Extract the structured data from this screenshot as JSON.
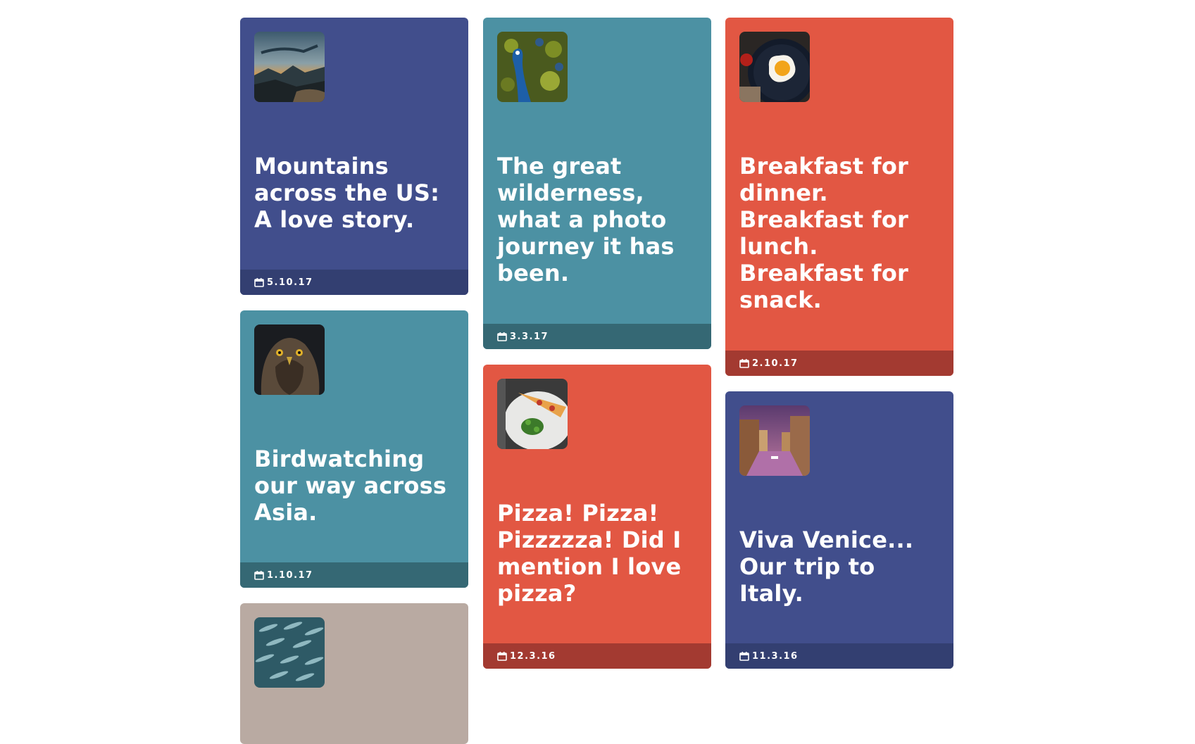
{
  "cards": [
    {
      "title": "Mountains across the US: A love story.",
      "date": "5.10.17",
      "color": "#414e8c",
      "footer_color": "#333f71",
      "image": "mountain-landscape-image",
      "date_icon": "calendar-icon"
    },
    {
      "title": "The great wilderness, what a photo journey it has been.",
      "date": "3.3.17",
      "color": "#4c91a3",
      "footer_color": "#356874",
      "image": "peacock-image",
      "date_icon": "calendar-icon"
    },
    {
      "title": "Breakfast for dinner. Breakfast for lunch. Breakfast for snack.",
      "date": "2.10.17",
      "color": "#e25743",
      "footer_color": "#a33a31",
      "image": "fried-egg-pan-image",
      "date_icon": "calendar-icon"
    },
    {
      "title": "Birdwatching our way across Asia.",
      "date": "1.10.17",
      "color": "#4c91a3",
      "footer_color": "#356874",
      "image": "hawk-image",
      "date_icon": "calendar-icon"
    },
    {
      "title": "Pizza! Pizza! Pizzzzza! Did I mention I love pizza?",
      "date": "12.3.16",
      "color": "#e25743",
      "footer_color": "#a33a31",
      "image": "pizza-plate-image",
      "date_icon": "calendar-icon"
    },
    {
      "title": "Viva Venice... Our trip to Italy.",
      "date": "11.3.16",
      "color": "#414e8c",
      "footer_color": "#333f71",
      "image": "venice-canal-image",
      "date_icon": "calendar-icon"
    },
    {
      "title": "",
      "date": "",
      "color": "#b9aaa2",
      "footer_color": "#8f827b",
      "image": "fish-school-image",
      "date_icon": ""
    }
  ]
}
